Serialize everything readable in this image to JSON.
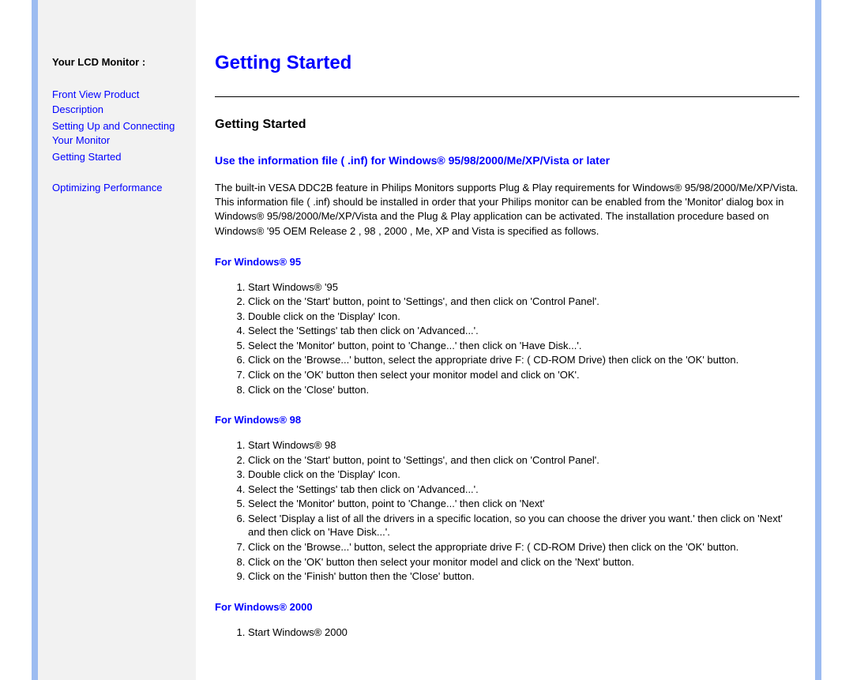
{
  "sidebar": {
    "title": "Your LCD Monitor :",
    "links": [
      "Front View Product Description",
      "Setting Up and Connecting Your Monitor",
      "Getting Started"
    ],
    "extra_link": "Optimizing Performance"
  },
  "content": {
    "main_heading": "Getting Started",
    "section_heading": "Getting Started",
    "intro_blue": "Use the information file ( .inf) for Windows® 95/98/2000/Me/XP/Vista or later",
    "intro_para": "The built-in VESA DDC2B feature in Philips Monitors supports Plug & Play requirements for Windows® 95/98/2000/Me/XP/Vista. This information file ( .inf) should be installed in order that your Philips monitor can be enabled from the 'Monitor' dialog box in Windows® 95/98/2000/Me/XP/Vista and the Plug & Play application can be activated. The installation procedure based on Windows® '95 OEM Release 2 , 98 , 2000 , Me, XP and Vista is specified as follows.",
    "sections": [
      {
        "heading": "For Windows® 95",
        "steps": [
          "Start Windows® '95",
          "Click on the 'Start' button, point to 'Settings', and then click on 'Control Panel'.",
          "Double click on the 'Display' Icon.",
          "Select the 'Settings' tab then click on 'Advanced...'.",
          "Select the 'Monitor' button, point to 'Change...' then click on 'Have Disk...'.",
          "Click on the 'Browse...' button, select the appropriate drive F: ( CD-ROM Drive) then click on the 'OK' button.",
          "Click on the 'OK' button then select your monitor model and click on 'OK'.",
          "Click on the 'Close' button."
        ]
      },
      {
        "heading": "For Windows® 98",
        "steps": [
          "Start Windows® 98",
          "Click on the 'Start' button, point to 'Settings', and then click on 'Control Panel'.",
          "Double click on the 'Display' Icon.",
          "Select the 'Settings' tab then click on 'Advanced...'.",
          "Select the 'Monitor' button, point to 'Change...' then click on 'Next'",
          "Select 'Display a list of all the drivers in a specific location, so you can choose the driver you want.' then click on 'Next' and then click on 'Have Disk...'.",
          "Click on the 'Browse...' button, select the appropriate drive F: ( CD-ROM Drive) then click on the 'OK' button.",
          "Click on the 'OK' button then select your monitor model and click on the 'Next' button.",
          "Click on the 'Finish' button then the 'Close' button."
        ]
      },
      {
        "heading": "For Windows® 2000",
        "steps": [
          "Start Windows® 2000"
        ]
      }
    ]
  }
}
